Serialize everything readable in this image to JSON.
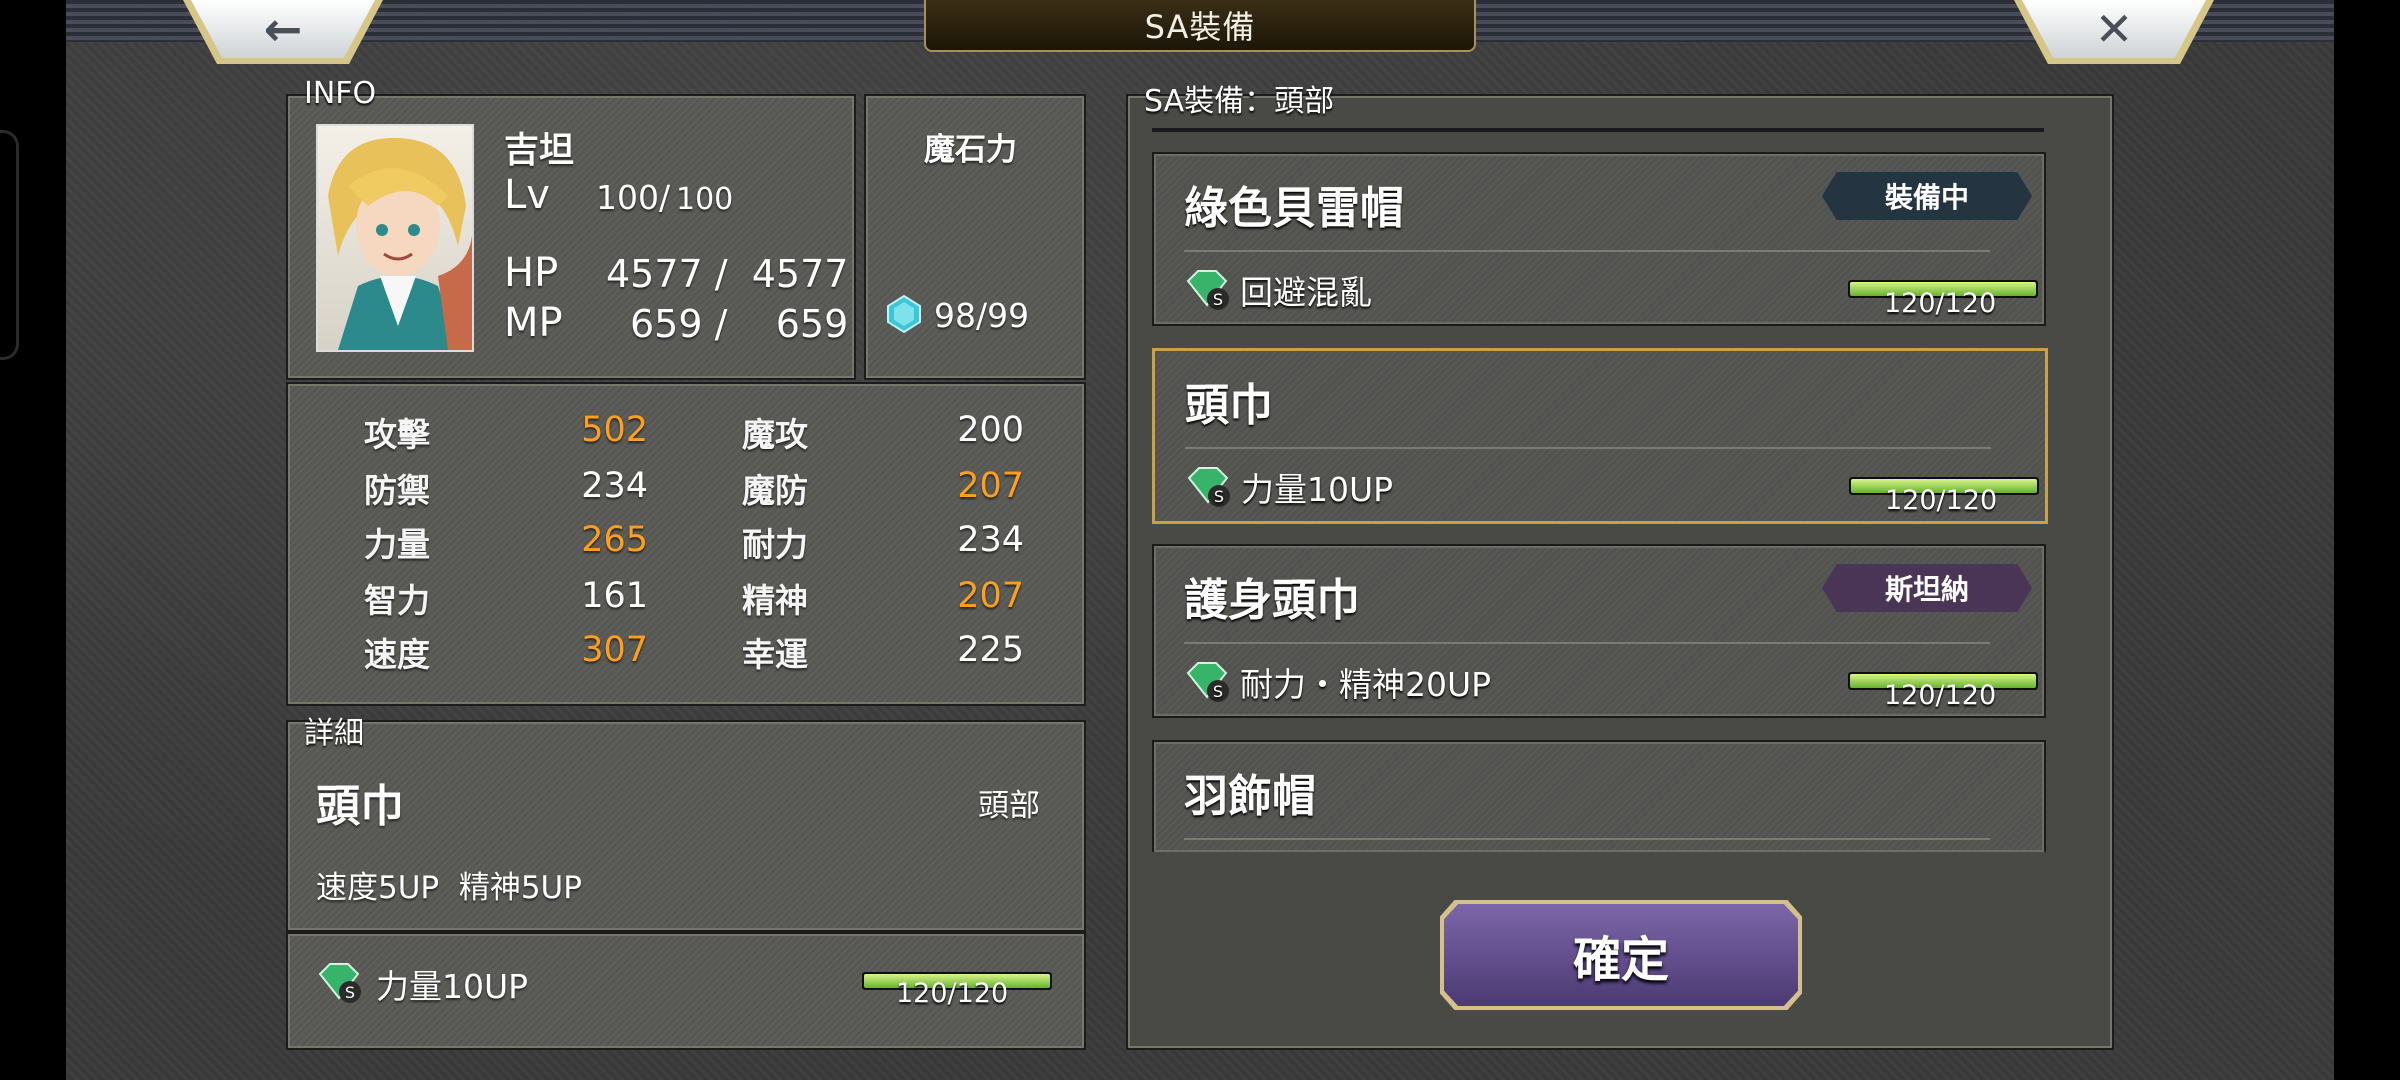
{
  "header": {
    "title": "SA裝備",
    "back_icon": "←",
    "close_icon": "✕"
  },
  "info": {
    "section_label": "INFO",
    "name": "吉坦",
    "lv_label": "Lv",
    "lv_current": "100/",
    "lv_max": "100",
    "hp_label": "HP",
    "hp_value": "4577 /  4577",
    "mp_label": "MP",
    "mp_value": "659 /    659",
    "magicite_label": "魔石力",
    "magicite_value": "98/99"
  },
  "stats": [
    {
      "name": "攻擊",
      "value": "502",
      "highlight": true
    },
    {
      "name": "魔攻",
      "value": "200",
      "highlight": false
    },
    {
      "name": "防禦",
      "value": "234",
      "highlight": false
    },
    {
      "name": "魔防",
      "value": "207",
      "highlight": true
    },
    {
      "name": "力量",
      "value": "265",
      "highlight": true
    },
    {
      "name": "耐力",
      "value": "234",
      "highlight": false
    },
    {
      "name": "智力",
      "value": "161",
      "highlight": false
    },
    {
      "name": "精神",
      "value": "207",
      "highlight": true
    },
    {
      "name": "速度",
      "value": "307",
      "highlight": true
    },
    {
      "name": "幸運",
      "value": "225",
      "highlight": false
    }
  ],
  "details": {
    "section_label": "詳細",
    "item_name": "頭巾",
    "slot": "頭部",
    "effect": "速度5UP  精神5UP",
    "skill": "力量10UP",
    "progress_text": "120/120",
    "progress": 1.0
  },
  "equip_list": {
    "section_label": "SA裝備：頭部",
    "items": [
      {
        "name": "綠色貝雷帽",
        "skill": "回避混亂",
        "progress_text": "120/120",
        "progress": 1.0,
        "badge": "裝備中",
        "badge_color": "#243440",
        "selected": false
      },
      {
        "name": "頭巾",
        "skill": "力量10UP",
        "progress_text": "120/120",
        "progress": 1.0,
        "badge": "",
        "badge_color": "",
        "selected": true
      },
      {
        "name": "護身頭巾",
        "skill": "耐力・精神20UP",
        "progress_text": "120/120",
        "progress": 1.0,
        "badge": "斯坦納",
        "badge_color": "#4a3557",
        "selected": false
      },
      {
        "name": "羽飾帽",
        "skill": "",
        "progress_text": "",
        "progress": 0,
        "badge": "",
        "badge_color": "",
        "selected": false
      }
    ]
  },
  "confirm_label": "確定",
  "colors": {
    "highlight": "#ff9f1a",
    "selected_border": "#c8a24a",
    "confirm": "#5b4886"
  }
}
